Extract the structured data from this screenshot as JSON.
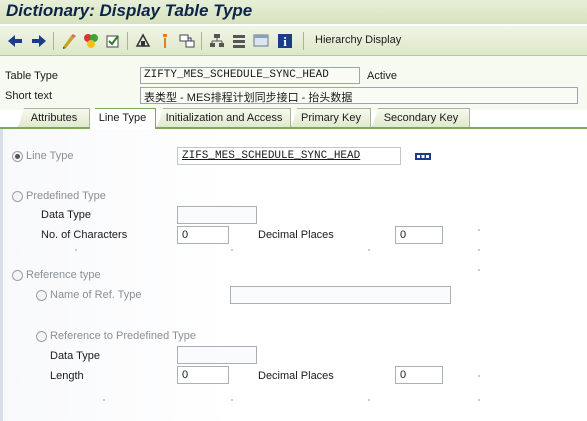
{
  "window": {
    "title": "Dictionary: Display Table Type"
  },
  "toolbar": {
    "icons": [
      "back-arrow-icon",
      "forward-arrow-icon",
      "display-change-icon",
      "activate-icon",
      "check-icon",
      "object-list-icon",
      "where-used-icon",
      "navigate-icon",
      "hierarchy-icon",
      "tree-icon",
      "screen-icon",
      "info-icon"
    ],
    "hierarchy_label": "Hierarchy Display"
  },
  "header": {
    "table_type_label": "Table Type",
    "table_type_value": "ZIFTY_MES_SCHEDULE_SYNC_HEAD",
    "status": "Active",
    "short_text_label": "Short text",
    "short_text_value": "表类型 - MES排程计划同步接口 - 抬头数据"
  },
  "tabs": [
    {
      "label": "Attributes",
      "active": false
    },
    {
      "label": "Line Type",
      "active": true
    },
    {
      "label": "Initialization and Access",
      "active": false
    },
    {
      "label": "Primary Key",
      "active": false
    },
    {
      "label": "Secondary Key",
      "active": false
    }
  ],
  "line_type": {
    "radio_line_type_label": "Line Type",
    "line_type_value": "ZIFS_MES_SCHEDULE_SYNC_HEAD",
    "radio_predefined_label": "Predefined Type",
    "data_type_label": "Data Type",
    "data_type_value": "",
    "no_chars_label": "No. of Characters",
    "no_chars_value": "0",
    "decimal_places_label": "Decimal Places",
    "decimal_places_value": "0",
    "radio_reference_label": "Reference type",
    "radio_ref_name_label": "Name of Ref. Type",
    "ref_name_value": "",
    "radio_ref_predefined_label": "Reference to Predefined Type",
    "ref_data_type_label": "Data Type",
    "ref_data_type_value": "",
    "length_label": "Length",
    "length_value": "0",
    "ref_decimal_places_label": "Decimal Places",
    "ref_decimal_places_value": "0",
    "selected": "line_type"
  }
}
